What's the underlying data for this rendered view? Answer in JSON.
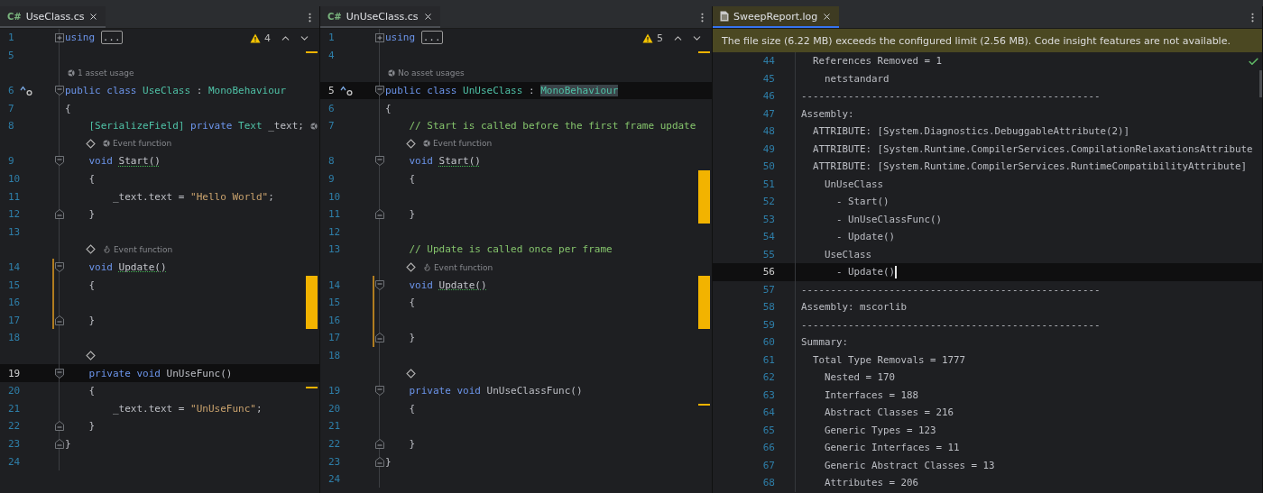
{
  "panes": [
    {
      "kind": "code",
      "tab": {
        "kind": "cs",
        "icon_text": "C#",
        "label": "UseClass.cs",
        "selected": false
      },
      "warnings": "4",
      "rows": [
        {
          "kind": "code",
          "number": "1",
          "current": false,
          "changed": false,
          "fold": {
            "kind": "collapsed"
          },
          "tokens": [
            {
              "kind": "kw",
              "t": "using"
            },
            {
              "kind": "folded",
              "t": "..."
            }
          ]
        },
        {
          "kind": "code",
          "number": "5",
          "current": false,
          "changed": false,
          "marker": {
            "kind": "line"
          }
        },
        {
          "kind": "hint",
          "diamond": false,
          "icon": {
            "kind": "trefoil"
          },
          "text": "1 asset usage"
        },
        {
          "kind": "code",
          "number": "6",
          "current": false,
          "changed": false,
          "gutter_icon": {
            "kind": "implemented"
          },
          "fold": {
            "kind": "start"
          },
          "tokens": [
            {
              "kind": "kw",
              "t": "public"
            },
            {
              "kind": "kw",
              "t": "class"
            },
            {
              "kind": "type",
              "t": "UseClass"
            },
            {
              "kind": "plain",
              "t": ":"
            },
            {
              "kind": "type",
              "t": "MonoBehaviour"
            }
          ]
        },
        {
          "kind": "code",
          "number": "7",
          "current": false,
          "changed": false,
          "tokens": [
            {
              "kind": "plain",
              "t": "{"
            }
          ],
          "children": [
            {
              "kind": "code",
              "number": "8",
              "current": false,
              "changed": false,
              "trailing_icon": {
                "kind": "trefoil"
              },
              "tokens": [
                {
                  "kind": "attr",
                  "t": "[SerializeField]"
                },
                {
                  "kind": "kw",
                  "t": "private"
                },
                {
                  "kind": "type",
                  "t": "Text"
                },
                {
                  "kind": "plain",
                  "t": "_text;"
                }
              ]
            },
            {
              "kind": "hint",
              "diamond": true,
              "icon": {
                "kind": "trefoil"
              },
              "text": "Event function"
            },
            {
              "kind": "code",
              "number": "9",
              "current": false,
              "changed": false,
              "fold": {
                "kind": "start"
              },
              "tokens": [
                {
                  "kind": "kw",
                  "t": "void"
                },
                {
                  "kind": "method",
                  "t": "Start()"
                }
              ]
            },
            {
              "kind": "code",
              "number": "10",
              "current": false,
              "changed": false,
              "tokens": [
                {
                  "kind": "plain",
                  "t": "{"
                }
              ],
              "children": [
                {
                  "kind": "code",
                  "number": "11",
                  "current": false,
                  "changed": false,
                  "tokens": [
                    {
                      "kind": "plain",
                      "t": "_text.text"
                    },
                    {
                      "kind": "plain",
                      "t": "="
                    },
                    {
                      "kind": "str",
                      "t": "\"Hello World\";"
                    }
                  ]
                }
              ]
            },
            {
              "kind": "code",
              "number": "12",
              "current": false,
              "changed": false,
              "fold": {
                "kind": "end"
              },
              "tokens": [
                {
                  "kind": "plain",
                  "t": "}"
                }
              ]
            },
            {
              "kind": "code",
              "number": "13",
              "current": false,
              "changed": false
            },
            {
              "kind": "hint",
              "diamond": true,
              "icon": {
                "kind": "flame"
              },
              "text": "Event function"
            },
            {
              "kind": "code",
              "number": "14",
              "current": false,
              "changed": true,
              "fold": {
                "kind": "start"
              },
              "tokens": [
                {
                  "kind": "kw",
                  "t": "void"
                },
                {
                  "kind": "method",
                  "t": "Update()"
                }
              ]
            },
            {
              "kind": "code",
              "number": "15",
              "current": false,
              "changed": true,
              "marker": {
                "kind": "block"
              },
              "tokens": [
                {
                  "kind": "plain",
                  "t": "{"
                }
              ],
              "children": [
                {
                  "kind": "code",
                  "number": "16",
                  "current": false,
                  "changed": true,
                  "marker": {
                    "kind": "block"
                  }
                }
              ]
            },
            {
              "kind": "code",
              "number": "17",
              "current": false,
              "changed": true,
              "marker": {
                "kind": "block"
              },
              "fold": {
                "kind": "end"
              },
              "tokens": [
                {
                  "kind": "plain",
                  "t": "}"
                }
              ]
            },
            {
              "kind": "code",
              "number": "18",
              "current": false,
              "changed": false
            },
            {
              "kind": "hint",
              "diamond": true
            },
            {
              "kind": "code",
              "number": "19",
              "current": true,
              "changed": false,
              "fold": {
                "kind": "start"
              },
              "tokens": [
                {
                  "kind": "kw",
                  "t": "private"
                },
                {
                  "kind": "kw",
                  "t": "void"
                },
                {
                  "kind": "plain",
                  "t": "UnUseFunc()"
                }
              ]
            },
            {
              "kind": "code",
              "number": "20",
              "current": false,
              "changed": false,
              "marker": {
                "kind": "line"
              },
              "tokens": [
                {
                  "kind": "plain",
                  "t": "{"
                }
              ],
              "children": [
                {
                  "kind": "code",
                  "number": "21",
                  "current": false,
                  "changed": false,
                  "tokens": [
                    {
                      "kind": "plain",
                      "t": "_text.text"
                    },
                    {
                      "kind": "plain",
                      "t": "="
                    },
                    {
                      "kind": "str",
                      "t": "\"UnUseFunc\";"
                    }
                  ]
                }
              ]
            },
            {
              "kind": "code",
              "number": "22",
              "current": false,
              "changed": false,
              "fold": {
                "kind": "end"
              },
              "tokens": [
                {
                  "kind": "plain",
                  "t": "}"
                }
              ]
            }
          ]
        },
        {
          "kind": "code",
          "number": "23",
          "current": false,
          "changed": false,
          "fold": {
            "kind": "end"
          },
          "tokens": [
            {
              "kind": "plain",
              "t": "}"
            }
          ]
        },
        {
          "kind": "code",
          "number": "24",
          "current": false,
          "changed": false
        }
      ]
    },
    {
      "kind": "code",
      "tab": {
        "kind": "cs",
        "icon_text": "C#",
        "label": "UnUseClass.cs",
        "selected": false
      },
      "warnings": "5",
      "rows": [
        {
          "kind": "code",
          "number": "1",
          "current": false,
          "changed": false,
          "fold": {
            "kind": "collapsed"
          },
          "tokens": [
            {
              "kind": "kw",
              "t": "using"
            },
            {
              "kind": "folded",
              "t": "..."
            }
          ]
        },
        {
          "kind": "code",
          "number": "4",
          "current": false,
          "changed": false,
          "marker": {
            "kind": "line"
          }
        },
        {
          "kind": "hint",
          "diamond": false,
          "icon": {
            "kind": "trefoil"
          },
          "text": "No asset usages"
        },
        {
          "kind": "code",
          "number": "5",
          "current": true,
          "changed": false,
          "gutter_icon": {
            "kind": "implemented"
          },
          "fold": {
            "kind": "start"
          },
          "tokens": [
            {
              "kind": "kw",
              "t": "public"
            },
            {
              "kind": "kw",
              "t": "class"
            },
            {
              "kind": "type",
              "t": "UnUseClass"
            },
            {
              "kind": "plain",
              "t": ":"
            },
            {
              "kind": "type_hl",
              "t": "MonoBehaviour"
            }
          ]
        },
        {
          "kind": "code",
          "number": "6",
          "current": false,
          "changed": false,
          "tokens": [
            {
              "kind": "plain",
              "t": "{"
            }
          ],
          "children": [
            {
              "kind": "code",
              "number": "7",
              "current": false,
              "changed": false,
              "tokens": [
                {
                  "kind": "comment",
                  "t": "// Start is called before the first frame update"
                }
              ]
            },
            {
              "kind": "hint",
              "diamond": true,
              "icon": {
                "kind": "trefoil"
              },
              "text": "Event function"
            },
            {
              "kind": "code",
              "number": "8",
              "current": false,
              "changed": false,
              "fold": {
                "kind": "start"
              },
              "tokens": [
                {
                  "kind": "kw",
                  "t": "void"
                },
                {
                  "kind": "method",
                  "t": "Start()"
                }
              ]
            },
            {
              "kind": "code",
              "number": "9",
              "current": false,
              "changed": false,
              "marker": {
                "kind": "block"
              },
              "tokens": [
                {
                  "kind": "plain",
                  "t": "{"
                }
              ],
              "children": [
                {
                  "kind": "code",
                  "number": "10",
                  "current": false,
                  "changed": false,
                  "marker": {
                    "kind": "block"
                  }
                }
              ]
            },
            {
              "kind": "code",
              "number": "11",
              "current": false,
              "changed": false,
              "marker": {
                "kind": "block"
              },
              "fold": {
                "kind": "end"
              },
              "tokens": [
                {
                  "kind": "plain",
                  "t": "}"
                }
              ]
            },
            {
              "kind": "code",
              "number": "12",
              "current": false,
              "changed": false
            },
            {
              "kind": "code",
              "number": "13",
              "current": false,
              "changed": false,
              "tokens": [
                {
                  "kind": "comment",
                  "t": "// Update is called once per frame"
                }
              ]
            },
            {
              "kind": "hint",
              "diamond": true,
              "icon": {
                "kind": "flame"
              },
              "text": "Event function"
            },
            {
              "kind": "code",
              "number": "14",
              "current": false,
              "changed": true,
              "marker": {
                "kind": "block"
              },
              "fold": {
                "kind": "start"
              },
              "tokens": [
                {
                  "kind": "kw",
                  "t": "void"
                },
                {
                  "kind": "method",
                  "t": "Update()"
                }
              ]
            },
            {
              "kind": "code",
              "number": "15",
              "current": false,
              "changed": true,
              "marker": {
                "kind": "block"
              },
              "tokens": [
                {
                  "kind": "plain",
                  "t": "{"
                }
              ],
              "children": [
                {
                  "kind": "code",
                  "number": "16",
                  "current": false,
                  "changed": true,
                  "marker": {
                    "kind": "block"
                  }
                }
              ]
            },
            {
              "kind": "code",
              "number": "17",
              "current": false,
              "changed": true,
              "fold": {
                "kind": "end"
              },
              "tokens": [
                {
                  "kind": "plain",
                  "t": "}"
                }
              ]
            },
            {
              "kind": "code",
              "number": "18",
              "current": false,
              "changed": false
            },
            {
              "kind": "hint",
              "diamond": true
            },
            {
              "kind": "code",
              "number": "19",
              "current": false,
              "changed": false,
              "fold": {
                "kind": "start"
              },
              "tokens": [
                {
                  "kind": "kw",
                  "t": "private"
                },
                {
                  "kind": "kw",
                  "t": "void"
                },
                {
                  "kind": "plain",
                  "t": "UnUseClassFunc()"
                }
              ]
            },
            {
              "kind": "code",
              "number": "20",
              "current": false,
              "changed": false,
              "marker": {
                "kind": "line"
              },
              "tokens": [
                {
                  "kind": "plain",
                  "t": "{"
                }
              ],
              "children": [
                {
                  "kind": "code",
                  "number": "21",
                  "current": false,
                  "changed": false
                }
              ]
            },
            {
              "kind": "code",
              "number": "22",
              "current": false,
              "changed": false,
              "fold": {
                "kind": "end"
              },
              "tokens": [
                {
                  "kind": "plain",
                  "t": "}"
                }
              ]
            }
          ]
        },
        {
          "kind": "code",
          "number": "23",
          "current": false,
          "changed": false,
          "fold": {
            "kind": "end"
          },
          "tokens": [
            {
              "kind": "plain",
              "t": "}"
            }
          ]
        },
        {
          "kind": "code",
          "number": "24",
          "current": false,
          "changed": false
        }
      ]
    },
    {
      "kind": "log",
      "tab": {
        "kind": "log",
        "label": "SweepReport.log",
        "selected": true
      },
      "banner": "The file size (6.22 MB) exceeds the configured limit (2.56 MB). Code insight features are not available.",
      "rows": [
        {
          "children": [
            {
              "number": "44",
              "current": false,
              "text": "References Removed = 1",
              "children": [
                {
                  "number": "45",
                  "current": false,
                  "text": "netstandard"
                }
              ]
            }
          ]
        },
        {
          "number": "46",
          "current": false,
          "text": "---------------------------------------------------"
        },
        {
          "number": "47",
          "current": false,
          "text": "Assembly:",
          "children": [
            {
              "number": "48",
              "current": false,
              "text": "ATTRIBUTE: [System.Diagnostics.DebuggableAttribute(2)]"
            },
            {
              "number": "49",
              "current": false,
              "text": "ATTRIBUTE: [System.Runtime.CompilerServices.CompilationRelaxationsAttribute"
            },
            {
              "number": "50",
              "current": false,
              "text": "ATTRIBUTE: [System.Runtime.CompilerServices.RuntimeCompatibilityAttribute]",
              "children": [
                {
                  "number": "51",
                  "current": false,
                  "text": "UnUseClass",
                  "children": [
                    {
                      "number": "52",
                      "current": false,
                      "text": "- Start()"
                    },
                    {
                      "number": "53",
                      "current": false,
                      "text": "- UnUseClassFunc()"
                    },
                    {
                      "number": "54",
                      "current": false,
                      "text": "- Update()"
                    }
                  ]
                },
                {
                  "number": "55",
                  "current": false,
                  "text": "UseClass",
                  "children": [
                    {
                      "number": "56",
                      "current": true,
                      "text": "- Update()"
                    }
                  ]
                }
              ]
            }
          ]
        },
        {
          "number": "57",
          "current": false,
          "text": "---------------------------------------------------"
        },
        {
          "number": "58",
          "current": false,
          "text": "Assembly: mscorlib"
        },
        {
          "number": "59",
          "current": false,
          "text": "---------------------------------------------------"
        },
        {
          "number": "60",
          "current": false,
          "text": "Summary:",
          "children": [
            {
              "number": "61",
              "current": false,
              "text": "Total Type Removals = 1777",
              "children": [
                {
                  "number": "62",
                  "current": false,
                  "text": "Nested = 170"
                },
                {
                  "number": "63",
                  "current": false,
                  "text": "Interfaces = 188"
                },
                {
                  "number": "64",
                  "current": false,
                  "text": "Abstract Classes = 216"
                },
                {
                  "number": "65",
                  "current": false,
                  "text": "Generic Types = 123"
                },
                {
                  "number": "66",
                  "current": false,
                  "text": "Generic Interfaces = 11"
                },
                {
                  "number": "67",
                  "current": false,
                  "text": "Generic Abstract Classes = 13"
                },
                {
                  "number": "68",
                  "current": false,
                  "text": "Attributes = 206"
                }
              ]
            }
          ]
        }
      ]
    }
  ]
}
